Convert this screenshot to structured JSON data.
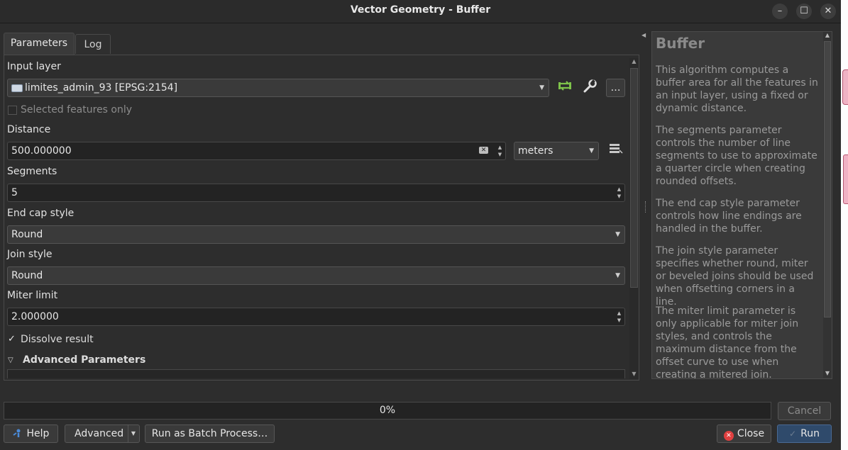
{
  "window": {
    "title": "Vector Geometry - Buffer",
    "minimize_icon": "–",
    "maximize_icon": "☐",
    "close_icon": "✕"
  },
  "tabs": [
    {
      "label": "Parameters",
      "active": true
    },
    {
      "label": "Log",
      "active": false
    }
  ],
  "params": {
    "input_layer_label": "Input layer",
    "input_layer_value": "limites_admin_93 [EPSG:2154]",
    "more_button": "…",
    "selected_only_label": "Selected features only",
    "selected_only_checked": false,
    "distance_label": "Distance",
    "distance_value": "500.000000",
    "distance_unit": "meters",
    "segments_label": "Segments",
    "segments_value": "5",
    "end_cap_label": "End cap style",
    "end_cap_value": "Round",
    "join_style_label": "Join style",
    "join_style_value": "Round",
    "miter_label": "Miter limit",
    "miter_value": "2.000000",
    "dissolve_label": "Dissolve result",
    "dissolve_checked": true,
    "advanced_label": "Advanced Parameters"
  },
  "help": {
    "title": "Buffer",
    "paragraphs": [
      "This algorithm computes a buffer area for all the features in an input layer, using a fixed or dynamic distance.",
      "The segments parameter controls the number of line segments to use to approximate a quarter circle when creating rounded offsets.",
      "The end cap style parameter controls how line endings are handled in the buffer.",
      "The join style parameter specifies whether round, miter or beveled joins should be used when offsetting corners in a line.",
      "The miter limit parameter is only applicable for miter join styles, and controls the maximum distance from the offset curve to use when creating a mitered join."
    ]
  },
  "footer": {
    "progress_text": "0%",
    "progress": 0,
    "cancel_label": "Cancel",
    "help_label": "Help",
    "advanced_label": "Advanced",
    "batch_label": "Run as Batch Process…",
    "close_label": "Close",
    "run_label": "Run"
  },
  "colors": {
    "accent": "#2f4a6b",
    "success_green": "#7ec34a",
    "close_red": "#e04040"
  }
}
